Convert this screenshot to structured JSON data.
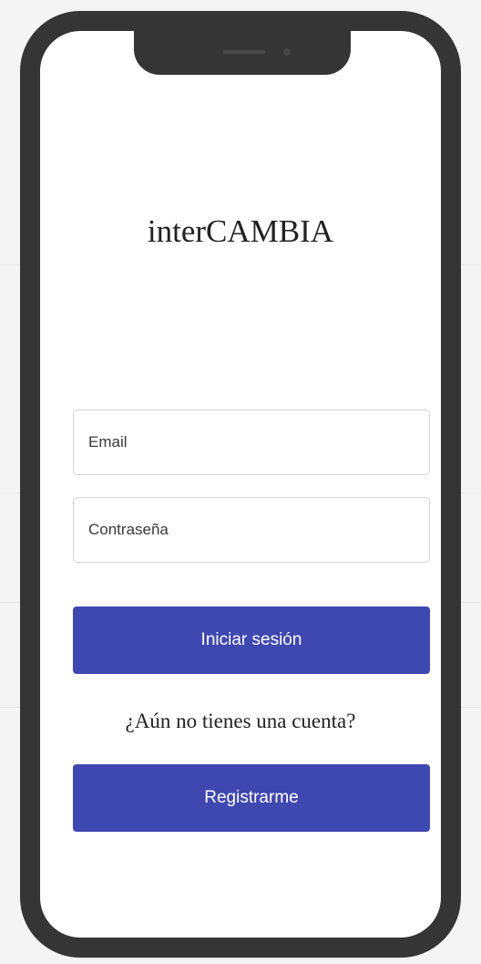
{
  "app": {
    "title": "interCAMBIA"
  },
  "login_form": {
    "email_placeholder": "Email",
    "password_placeholder": "Contraseña",
    "login_label": "Iniciar sesión",
    "no_account_text": "¿Aún no tienes una cuenta?",
    "register_label": "Registrarme"
  },
  "colors": {
    "button_bg": "#3f48b0",
    "phone_frame": "#353535",
    "button_text": "#ffffff"
  }
}
